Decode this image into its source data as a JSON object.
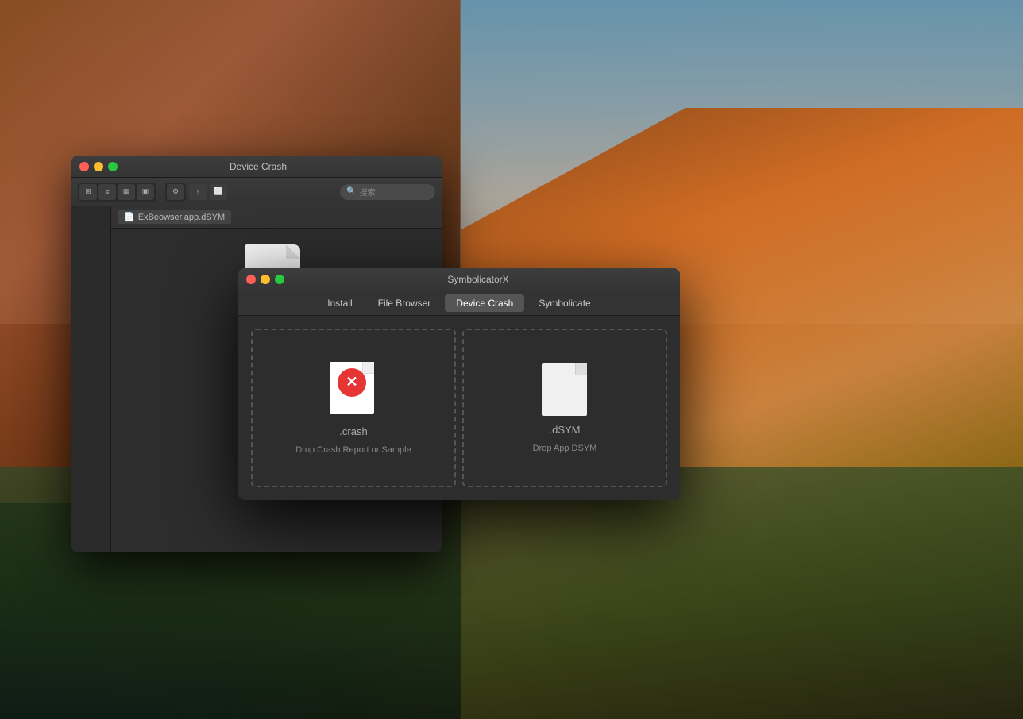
{
  "desktop": {
    "bg_description": "macOS Yosemite El Capitan wallpaper"
  },
  "finder_window": {
    "title": "Device Crash",
    "breadcrumb": "ExBeowser.app.dSYM",
    "search_placeholder": "搜索",
    "toolbar_buttons": [
      "grid",
      "list",
      "column",
      "cover",
      "group",
      "action",
      "share",
      "view"
    ]
  },
  "symbolicator_window": {
    "title": "SymbolicatorX",
    "tabs": [
      {
        "id": "install",
        "label": "Install",
        "active": false
      },
      {
        "id": "file-browser",
        "label": "File Browser",
        "active": false
      },
      {
        "id": "device-crash",
        "label": "Device Crash",
        "active": true
      },
      {
        "id": "symbolicate",
        "label": "Symbolicate",
        "active": false
      }
    ],
    "drop_zones": [
      {
        "id": "crash-drop",
        "extension": ".crash",
        "description": "Drop Crash Report or Sample"
      },
      {
        "id": "dsym-drop",
        "extension": ".dSYM",
        "description": "Drop App DSYM"
      }
    ]
  }
}
